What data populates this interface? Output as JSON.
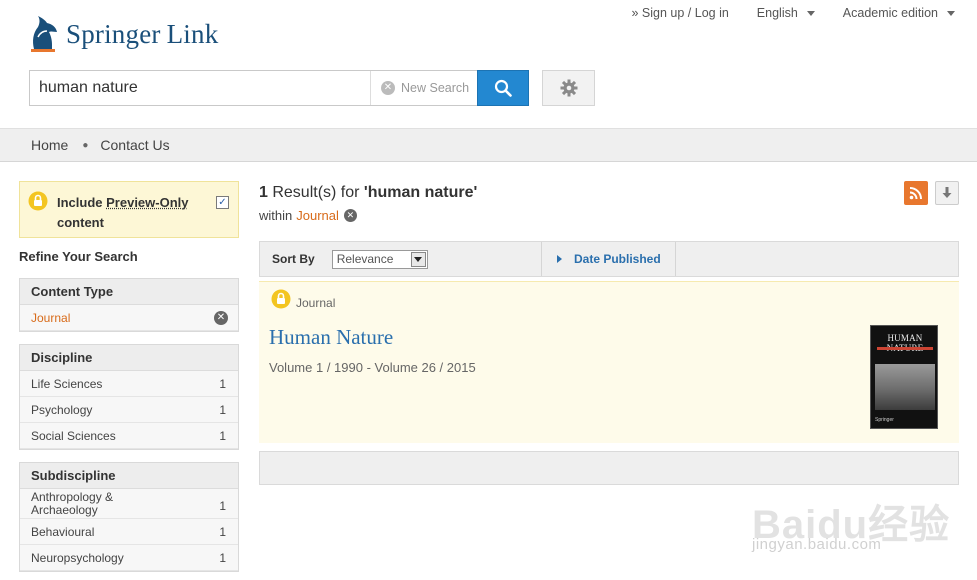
{
  "brand": {
    "name": "Springer",
    "suffix": "Link"
  },
  "topnav": {
    "signup": "» Sign up / Log in",
    "language": "English",
    "edition": "Academic edition"
  },
  "search": {
    "query": "human nature",
    "new_search": "New Search"
  },
  "breadcrumb": {
    "home": "Home",
    "contact": "Contact Us"
  },
  "sidebar": {
    "preview": {
      "label_prefix": "Include ",
      "label_link": "Preview-Only",
      "label_suffix": "content",
      "checked": true
    },
    "refine_title": "Refine Your Search",
    "content_type": {
      "title": "Content Type",
      "items": [
        {
          "label": "Journal"
        }
      ]
    },
    "discipline": {
      "title": "Discipline",
      "items": [
        {
          "label": "Life Sciences",
          "count": "1"
        },
        {
          "label": "Psychology",
          "count": "1"
        },
        {
          "label": "Social Sciences",
          "count": "1"
        }
      ]
    },
    "subdiscipline": {
      "title": "Subdiscipline",
      "items": [
        {
          "label": "Anthropology &",
          "label2": "Archaeology",
          "count": "1"
        },
        {
          "label": "Behavioural",
          "count": "1"
        },
        {
          "label": "Neuropsychology",
          "count": "1"
        }
      ]
    }
  },
  "results": {
    "count": "1",
    "text_mid": " Result(s) for ",
    "query_quoted": "'human nature'",
    "within_label": "within",
    "within_value": "Journal"
  },
  "sort": {
    "label": "Sort By",
    "selected": "Relevance",
    "date_published": "Date Published"
  },
  "item": {
    "type": "Journal",
    "title": "Human Nature",
    "meta": "Volume 1 / 1990 - Volume 26 / 2015",
    "cover_title": "HUMAN NATURE",
    "cover_publisher": "Springer"
  },
  "watermark": {
    "main": "Baidu经验",
    "sub": "jingyan.baidu.com"
  },
  "colors": {
    "accent": "#d86b1a",
    "link": "#2a6fad",
    "search_button": "#2388d1",
    "rss": "#e8772e"
  }
}
